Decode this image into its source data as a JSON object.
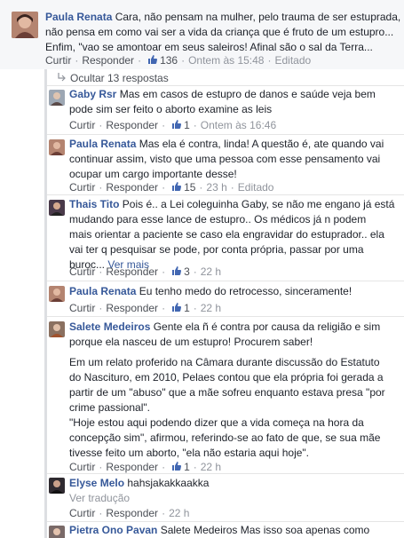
{
  "main_comment": {
    "author": "Paula Renata",
    "lines": [
      " Cara, não pensam na mulher, pelo trauma de ser estuprada,",
      "não pensa em como vai ser a vida da criança que é fruto de um estupro...",
      "Enfim, \"vao se amontoar em seus saleiros! Afinal são o sal da Terra..."
    ],
    "actions": {
      "like": "Curtir",
      "reply": "Responder",
      "likes": "136",
      "time": "Ontem às 15:48",
      "edited": "Editado"
    }
  },
  "hide_replies_label": "Ocultar 13 respostas",
  "replies": [
    {
      "author": "Gaby Rsr",
      "lines": [
        " Mas em casos de estupro de danos e saúde veja bem",
        "pode sim ser feito o aborto examine as leis"
      ],
      "actions": {
        "like": "Curtir",
        "reply": "Responder",
        "likes": "1",
        "time": "Ontem às 16:46"
      }
    },
    {
      "author": "Paula Renata",
      "lines": [
        " Mas ela é contra, linda! A questão é, ate quando vai",
        "continuar assim, visto que uma pessoa com esse pensamento vai",
        "ocupar um cargo importante desse!"
      ],
      "actions": {
        "like": "Curtir",
        "reply": "Responder",
        "likes": "15",
        "time": "23 h",
        "edited": "Editado"
      }
    },
    {
      "author": "Thais Tito",
      "lines": [
        " Pois é.. a Lei coleguinha Gaby, se não me engano já está",
        "mudando para esse lance de estupro.. Os médicos já n podem",
        "mais orientar a paciente se caso ela engravidar do estuprador.. ela",
        "vai ter q pesquisar se pode, por conta própria, passar por uma",
        "buroc..."
      ],
      "see_more": "Ver mais",
      "actions": {
        "like": "Curtir",
        "reply": "Responder",
        "likes": "3",
        "time": "22 h"
      }
    },
    {
      "author": "Paula Renata",
      "lines": [
        " Eu tenho medo do retrocesso, sinceramente!"
      ],
      "actions": {
        "like": "Curtir",
        "reply": "Responder",
        "likes": "1",
        "time": "22 h"
      }
    },
    {
      "author": "Salete Medeiros",
      "lines": [
        " Gente ela ñ é contra por causa da religião e sim",
        "porque ela nasceu de um estupro! Procurem saber!"
      ],
      "paragraphs": [
        [
          "Em um relato proferido na Câmara durante discussão do Estatuto",
          "do Nascituro, em 2010, Pelaes contou que ela própria foi gerada a",
          "partir de um \"abuso\" que a mãe sofreu enquanto estava presa \"por",
          "crime passional\"."
        ],
        [
          "\"Hoje estou aqui podendo dizer que a vida começa na hora da",
          "concepção sim\", afirmou, referindo-se ao fato de que, se sua mãe",
          "tivesse feito um aborto, \"ela não estaria aqui hoje\"."
        ]
      ],
      "actions": {
        "like": "Curtir",
        "reply": "Responder",
        "likes": "1",
        "time": "22 h"
      }
    },
    {
      "author": "Elyse Melo",
      "lines": [
        " hahsjakakkaakka"
      ],
      "translation": "Ver tradução",
      "actions": {
        "like": "Curtir",
        "reply": "Responder",
        "time": "22 h"
      }
    },
    {
      "author": "Pietra Ono Pavan",
      "lines": [
        " Salete Medeiros Mas isso soa apenas como"
      ]
    }
  ]
}
